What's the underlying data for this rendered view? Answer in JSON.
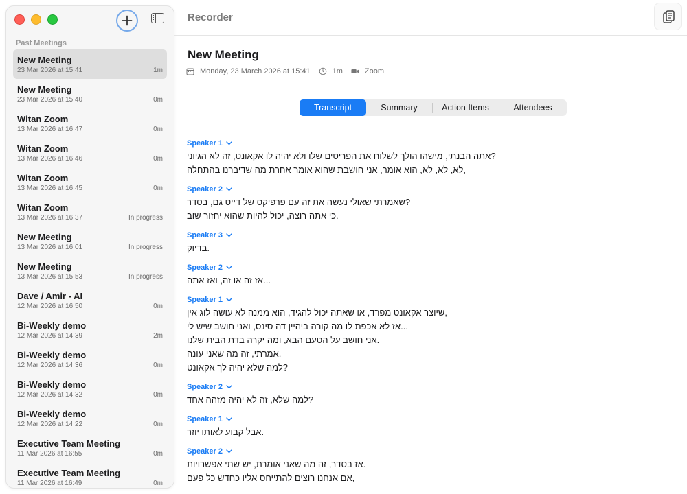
{
  "sidebar": {
    "section_header": "Past Meetings",
    "items": [
      {
        "title": "New Meeting",
        "date": "23 Mar 2026 at 15:41",
        "duration": "1m"
      },
      {
        "title": "New Meeting",
        "date": "23 Mar 2026 at 15:40",
        "duration": "0m"
      },
      {
        "title": "Witan Zoom",
        "date": "13 Mar 2026 at 16:47",
        "duration": "0m"
      },
      {
        "title": "Witan Zoom",
        "date": "13 Mar 2026 at 16:46",
        "duration": "0m"
      },
      {
        "title": "Witan Zoom",
        "date": "13 Mar 2026 at 16:45",
        "duration": "0m"
      },
      {
        "title": "Witan Zoom",
        "date": "13 Mar 2026 at 16:37",
        "duration": "In progress"
      },
      {
        "title": "New Meeting",
        "date": "13 Mar 2026 at 16:01",
        "duration": "In progress"
      },
      {
        "title": "New Meeting",
        "date": "13 Mar 2026 at 15:53",
        "duration": "In progress"
      },
      {
        "title": "Dave / Amir - AI",
        "date": "12 Mar 2026 at 16:50",
        "duration": "0m"
      },
      {
        "title": "Bi-Weekly demo",
        "date": "12 Mar 2026 at 14:39",
        "duration": "2m"
      },
      {
        "title": "Bi-Weekly demo",
        "date": "12 Mar 2026 at 14:36",
        "duration": "0m"
      },
      {
        "title": "Bi-Weekly demo",
        "date": "12 Mar 2026 at 14:32",
        "duration": "0m"
      },
      {
        "title": "Bi-Weekly demo",
        "date": "12 Mar 2026 at 14:22",
        "duration": "0m"
      },
      {
        "title": "Executive Team Meeting",
        "date": "11 Mar 2026 at 16:55",
        "duration": "0m"
      },
      {
        "title": "Executive Team Meeting",
        "date": "11 Mar 2026 at 16:49",
        "duration": "0m"
      }
    ]
  },
  "topbar": {
    "title": "Recorder"
  },
  "meeting": {
    "title": "New Meeting",
    "date": "Monday, 23 March 2026 at 15:41",
    "duration": "1m",
    "platform": "Zoom"
  },
  "tabs": [
    "Transcript",
    "Summary",
    "Action Items",
    "Attendees"
  ],
  "transcript": [
    {
      "speaker": "Speaker 1",
      "lines": [
        "אתה הבנתי, מישהו הולך לשלוח את הפריטים שלו ולא יהיה לו אקאונט, זה לא הגיוני?",
        "לא, לא, לא, הוא אומר, אני חושבת שהוא אומר אחרת מה שדיברנו בהתחלה,"
      ]
    },
    {
      "speaker": "Speaker 2",
      "lines": [
        "שאמרתי שאולי נעשה את זה עם פרפיקס של דייט גם, בסדר?",
        "כי אתה רוצה, יכול להיות שהוא יחזור שוב."
      ]
    },
    {
      "speaker": "Speaker 3",
      "lines": [
        "בדיוק."
      ]
    },
    {
      "speaker": "Speaker 2",
      "lines": [
        "אז זה או זה, ואז אתה..."
      ]
    },
    {
      "speaker": "Speaker 1",
      "lines": [
        "שיוצר אקאונט מפרד, או שאתה יכול להגיד, הוא ממנה לא עושה לוג אין,",
        "אז לא אכפת לו מה קורה ביהיין דה סינס, ואני חושב שיש לי...",
        "אני חושב על הטעם הבא, ומה יקרה בדת הבית שלנו.",
        "אמרתי, זה מה שאני עונה.",
        "למה שלא יהיה לך אקאונט?"
      ]
    },
    {
      "speaker": "Speaker 2",
      "lines": [
        "למה שלא, זה לא יהיה מזהה אחד?"
      ]
    },
    {
      "speaker": "Speaker 1",
      "lines": [
        "אבל קבוע לאותו יוזר."
      ]
    },
    {
      "speaker": "Speaker 2",
      "lines": [
        "אז בסדר, זה מה שאני אומרת, יש שתי אפשרויות.",
        "אם אנחנו רוצים להתייחס אליו כחדש כל פעם,"
      ]
    }
  ]
}
